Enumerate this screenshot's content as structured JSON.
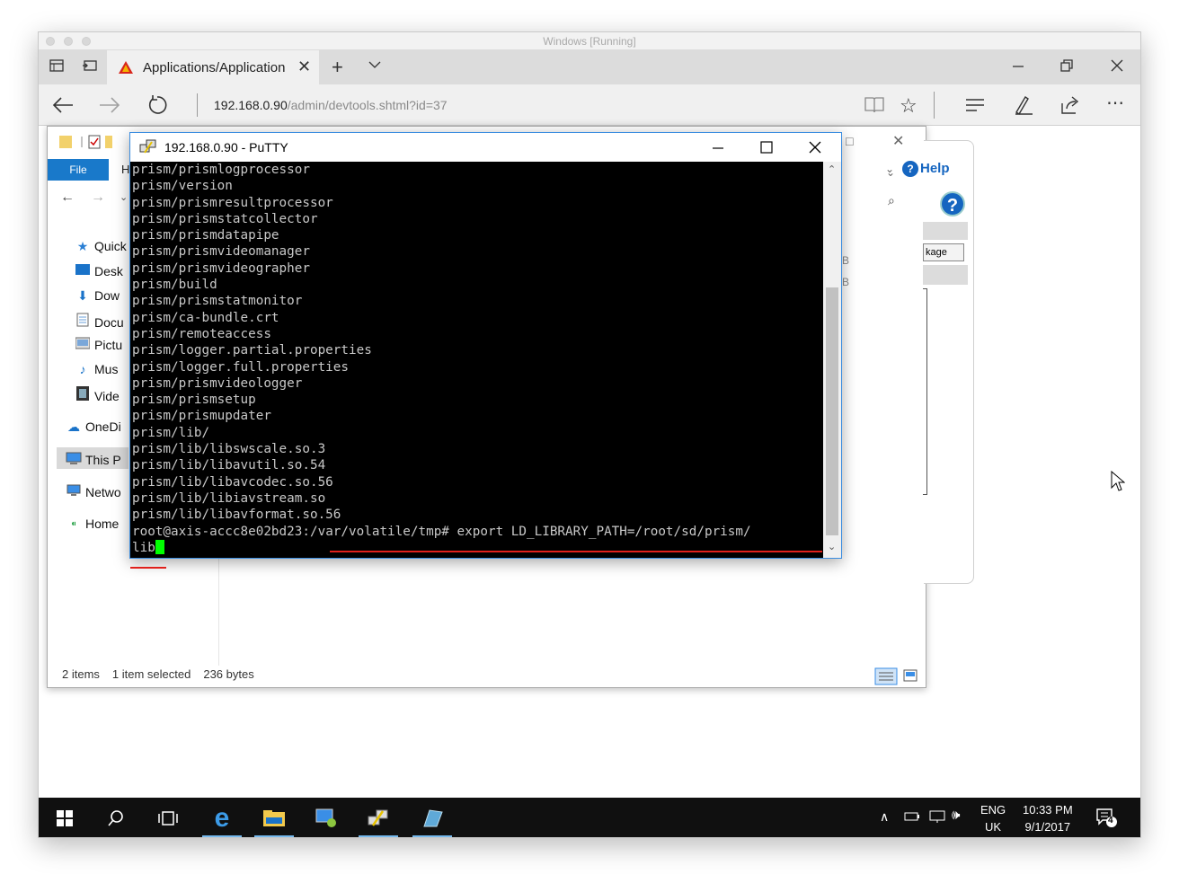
{
  "vm_window": {
    "title": "Windows [Running]"
  },
  "edge": {
    "tab_title": "Applications/Application",
    "url_host": "192.168.0.90",
    "url_path": "/admin/devtools.shtml?id=37"
  },
  "explorer": {
    "file_tab": "File",
    "nav_items": [
      "Quick",
      "Desk",
      "Dow",
      "Docu",
      "Pictu",
      "Mus",
      "Vide",
      "OneDi",
      "This P",
      "Netwo",
      "Home"
    ],
    "status_items": "2 items",
    "status_selected": "1 item selected",
    "status_size": "236 bytes"
  },
  "webpanel": {
    "help_label": "Help",
    "package_button": "kage",
    "size_letter_1": "B",
    "size_letter_2": "B"
  },
  "putty": {
    "title": "192.168.0.90 - PuTTY",
    "lines": [
      "prism/prismlogprocessor",
      "prism/version",
      "prism/prismresultprocessor",
      "prism/prismstatcollector",
      "prism/prismdatapipe",
      "prism/prismvideomanager",
      "prism/prismvideographer",
      "prism/build",
      "prism/prismstatmonitor",
      "prism/ca-bundle.crt",
      "prism/remoteaccess",
      "prism/logger.partial.properties",
      "prism/logger.full.properties",
      "prism/prismvideologger",
      "prism/prismsetup",
      "prism/prismupdater",
      "prism/lib/",
      "prism/lib/libswscale.so.3",
      "prism/lib/libavutil.so.54",
      "prism/lib/libavcodec.so.56",
      "prism/lib/libiavstream.so",
      "prism/lib/libavformat.so.56"
    ],
    "prompt": "root@axis-accc8e02bd23:",
    "command": "/var/volatile/tmp# export LD_LIBRARY_PATH=/root/sd/prism/",
    "command_wrap": "lib"
  },
  "taskbar": {
    "lang_top": "ENG",
    "lang_bottom": "UK",
    "time": "10:33 PM",
    "date": "9/1/2017",
    "notification_count": "4"
  },
  "colors": {
    "underline": "#e0201b",
    "cursor": "#00ff00",
    "file_tab": "#1979ca"
  }
}
